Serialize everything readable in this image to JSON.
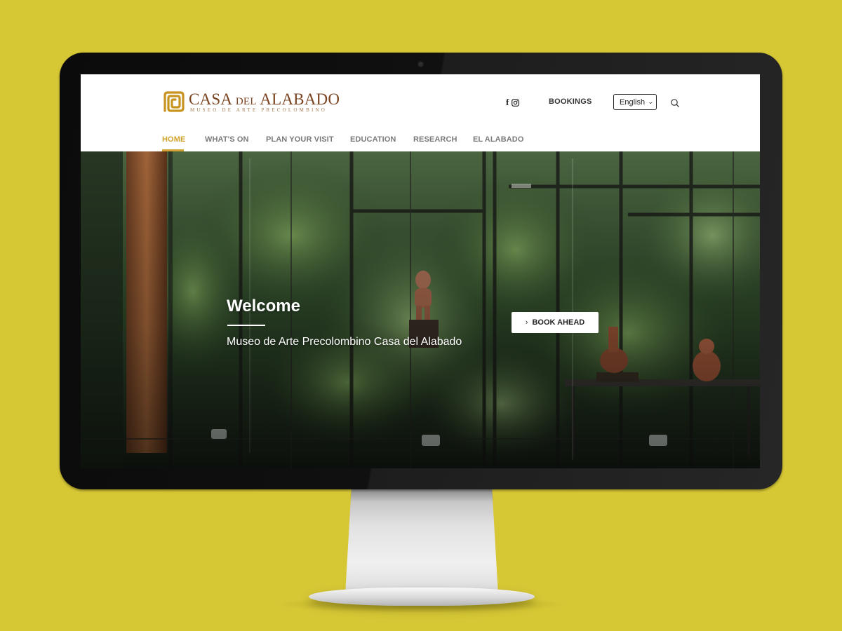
{
  "colors": {
    "background": "#d6c735",
    "accent": "#d1a32c",
    "logo": "#7a4421",
    "nav_text": "#7a7a7a"
  },
  "logo": {
    "title_casa": "CASA",
    "title_del": "DEL",
    "title_alabado": "ALABADO",
    "subtitle": "MUSEO DE ARTE PRECOLOMBINO",
    "icon": "spiral-logo-icon"
  },
  "header": {
    "social_icons": [
      "facebook-icon",
      "instagram-icon"
    ],
    "bookings_label": "BOOKINGS",
    "language": {
      "selected": "English"
    },
    "search_icon": "search-icon"
  },
  "nav": {
    "items": [
      {
        "label": "HOME",
        "active": true
      },
      {
        "label": "WHAT'S ON",
        "active": false
      },
      {
        "label": "PLAN YOUR VISIT",
        "active": false
      },
      {
        "label": "EDUCATION",
        "active": false
      },
      {
        "label": "RESEARCH",
        "active": false
      },
      {
        "label": "EL ALABADO",
        "active": false
      }
    ]
  },
  "hero": {
    "title": "Welcome",
    "subtitle": "Museo de Arte Precolombino Casa del Alabado",
    "button_label": "BOOK AHEAD",
    "button_icon": "chevron-right-icon"
  }
}
